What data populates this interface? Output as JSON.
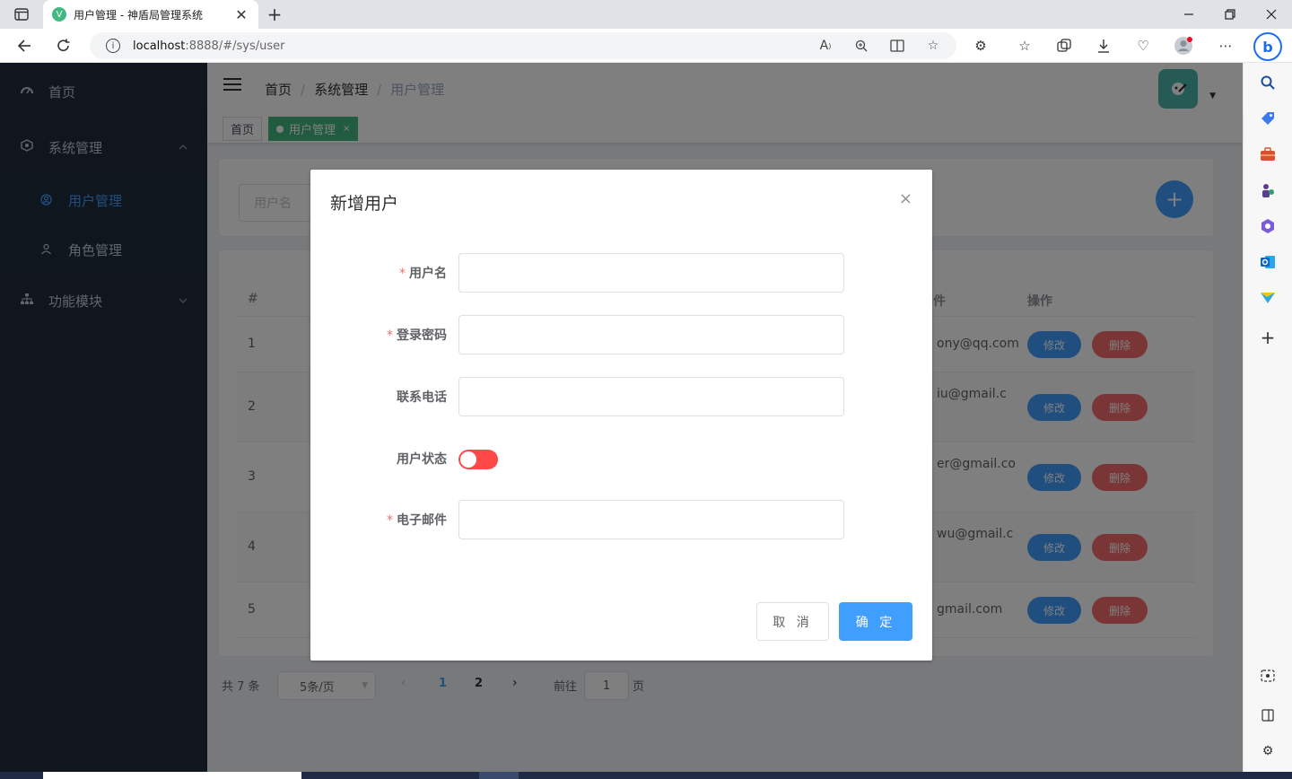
{
  "browser": {
    "tab_title": "用户管理 - 神盾局管理系统",
    "tab_favicon": "V",
    "url_host": "localhost",
    "url_rest": ":8888/#/sys/user",
    "close_glyph": "✕",
    "newtab_glyph": "+",
    "bing_glyph": "b"
  },
  "sidebar": {
    "items": [
      {
        "label": "首页",
        "icon": "dashboard-icon"
      },
      {
        "label": "系统管理",
        "icon": "system-icon",
        "expanded": true
      },
      {
        "label": "功能模块",
        "icon": "sitemap-icon",
        "expanded": false
      }
    ],
    "submenu": [
      {
        "label": "用户管理",
        "icon": "user-icon",
        "active": true
      },
      {
        "label": "角色管理",
        "icon": "role-icon",
        "active": false
      }
    ]
  },
  "header": {
    "breadcrumb": [
      "首页",
      "系统管理",
      "用户管理"
    ]
  },
  "tags": [
    {
      "label": "首页",
      "active": false
    },
    {
      "label": "用户管理",
      "active": true,
      "close": "×"
    }
  ],
  "search": {
    "placeholder": "用户名",
    "add_glyph": "+"
  },
  "table": {
    "columns": {
      "index": "#",
      "email": "邮件",
      "actions": "操作"
    },
    "rows": [
      {
        "index": "1",
        "email": "ony@qq.com"
      },
      {
        "index": "2",
        "email": "iu@gmail.c"
      },
      {
        "index": "3",
        "email": "er@gmail.co"
      },
      {
        "index": "4",
        "email": "wu@gmail.c"
      },
      {
        "index": "5",
        "email": "gmail.com"
      }
    ],
    "edit_label": "修改",
    "delete_label": "删除"
  },
  "pagination": {
    "total": "共 7 条",
    "page_size": "5条/页",
    "pages": [
      "1",
      "2"
    ],
    "current": "1",
    "goto_label": "前往",
    "goto_value": "1",
    "page_suffix": "页"
  },
  "dialog": {
    "title": "新增用户",
    "close_glyph": "×",
    "fields": [
      {
        "label": "用户名",
        "required": true,
        "type": "input",
        "value": ""
      },
      {
        "label": "登录密码",
        "required": true,
        "type": "input",
        "value": ""
      },
      {
        "label": "联系电话",
        "required": false,
        "type": "input",
        "value": ""
      },
      {
        "label": "用户状态",
        "required": false,
        "type": "switch",
        "value": false
      },
      {
        "label": "电子邮件",
        "required": true,
        "type": "input",
        "value": ""
      }
    ],
    "required_mark": "*",
    "cancel_label": "取 消",
    "confirm_label": "确 定"
  },
  "colors": {
    "primary": "#409eff",
    "danger": "#f56c6c",
    "switch_off": "#ff4949",
    "tag_active": "#42b983",
    "sidebar_bg": "#222c3c"
  }
}
